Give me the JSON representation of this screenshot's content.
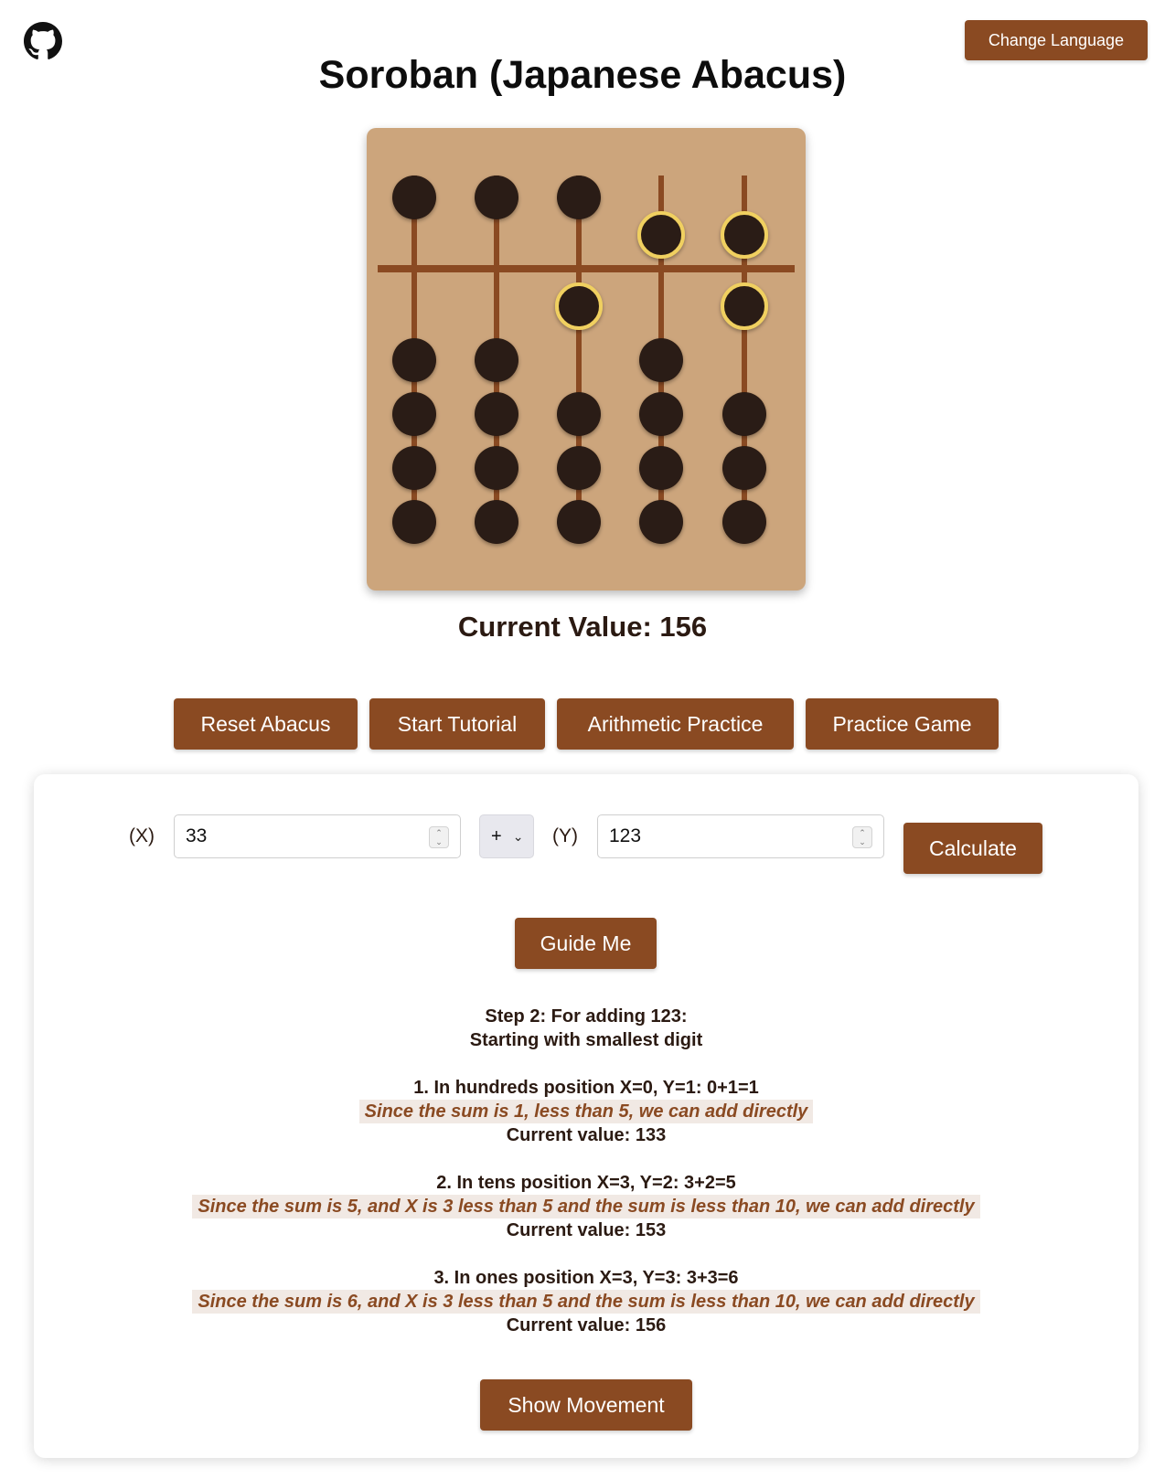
{
  "header": {
    "github_icon": "github-icon",
    "change_language_label": "Change Language",
    "title": "Soroban (Japanese Abacus)"
  },
  "abacus": {
    "digits": [
      0,
      0,
      1,
      5,
      6
    ],
    "highlighted_rods": [
      2,
      3,
      4
    ],
    "colors": {
      "frame": "#cca57c",
      "rod": "#8a4a22",
      "bead": "#2b1a12",
      "highlight": "#f0d060"
    }
  },
  "status": {
    "current_value": "Current Value: 156"
  },
  "actions": {
    "reset_label": "Reset Abacus",
    "tutorial_label": "Start Tutorial",
    "arithmetic_label": "Arithmetic Practice",
    "game_label": "Practice Game"
  },
  "practice": {
    "x_label": "(X)",
    "x_value": "33",
    "operator": "+",
    "y_label": "(Y)",
    "y_value": "123",
    "calculate_label": "Calculate",
    "guide_label": "Guide Me",
    "step_title": "Step 2: For adding 123:",
    "step_subtitle": "Starting with smallest digit",
    "steps": [
      {
        "heading": "1. In hundreds position X=0, Y=1: 0+1=1",
        "explanation": "Since the sum is 1, less than 5, we can add directly",
        "result": "Current value: 133"
      },
      {
        "heading": "2. In tens position X=3, Y=2: 3+2=5",
        "explanation": "Since the sum is 5, and X is 3 less than 5 and the sum is less than 10, we can add directly",
        "result": "Current value: 153"
      },
      {
        "heading": "3. In ones position X=3, Y=3: 3+3=6",
        "explanation": "Since the sum is 6, and X is 3 less than 5 and the sum is less than 10, we can add directly",
        "result": "Current value: 156"
      }
    ],
    "show_movement_label": "Show Movement"
  }
}
